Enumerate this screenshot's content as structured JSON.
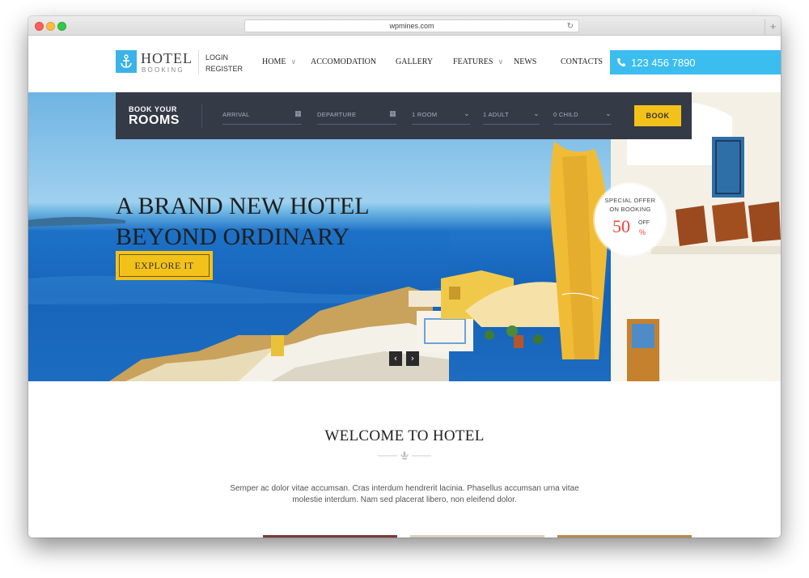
{
  "browser": {
    "url": "wpmines.com"
  },
  "logo": {
    "title": "HOTEL",
    "subtitle": "BOOKING"
  },
  "auth": {
    "login": "LOGIN",
    "register": "REGISTER"
  },
  "nav": {
    "home": "HOME",
    "accomodation": "ACCOMODATION",
    "gallery": "GALLERY",
    "features": "FEATURES",
    "news": "NEWS",
    "contacts": "CONTACTS"
  },
  "phone": "123 456 7890",
  "booking": {
    "label_small": "BOOK YOUR",
    "label_big": "ROOMS",
    "arrival": "ARRIVAL",
    "departure": "DEPARTURE",
    "rooms": "1 ROOM",
    "adults": "1 ADULT",
    "children": "0 CHILD",
    "book_button": "BOOK"
  },
  "hero": {
    "headline_line1": "A BRAND NEW HOTEL",
    "headline_line2": "BEYOND ORDINARY",
    "cta": "EXPLORE IT"
  },
  "offer": {
    "line1": "SPECIAL OFFER",
    "line2": "ON BOOKING",
    "value": "50",
    "off": "OFF",
    "percent": "%"
  },
  "slider": {
    "prev": "‹",
    "next": "›"
  },
  "welcome": {
    "title": "WELCOME TO HOTEL",
    "text": "Semper ac dolor vitae accumsan. Cras interdum hendrerit lacinia. Phasellus accumsan urna vitae molestie interdum. Nam sed placerat libero, non eleifend dolor."
  },
  "colors": {
    "accent_blue": "#3bbdf0",
    "accent_yellow": "#f3c21a",
    "booking_bar": "#353a47",
    "offer_red": "#e8453c"
  },
  "icons": {
    "logo": "anchor-icon",
    "phone": "phone-icon",
    "calendar": "calendar-icon",
    "dropdown": "chevron-down-icon"
  }
}
